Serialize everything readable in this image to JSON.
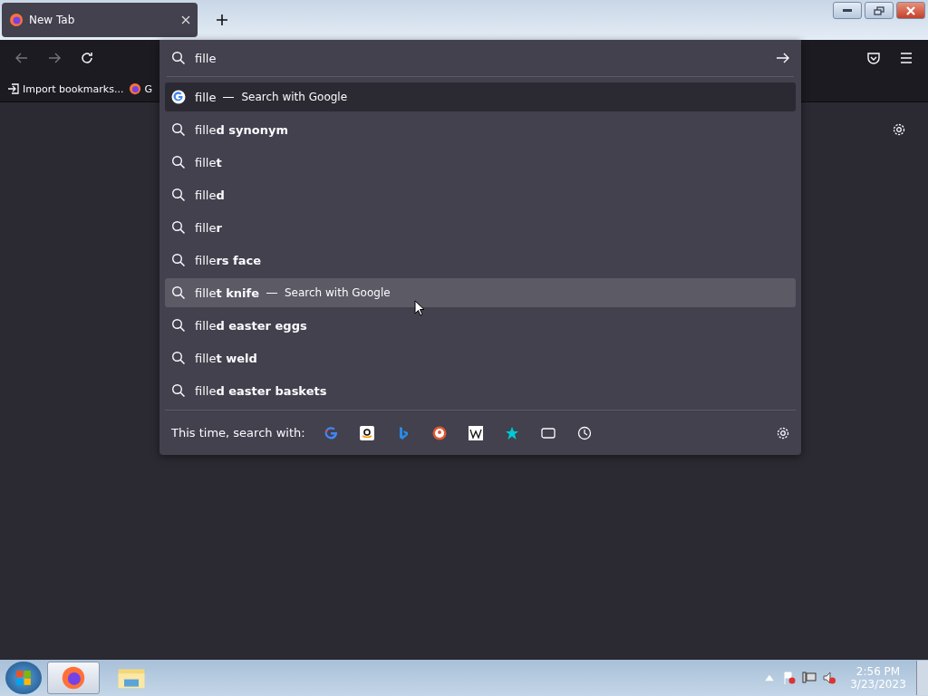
{
  "tab": {
    "title": "New Tab",
    "selected": true
  },
  "url_field": {
    "value": "fille"
  },
  "bookmarks": [
    "Import bookmarks...",
    "G"
  ],
  "suggestions": [
    {
      "kind": "engine",
      "text": "fille",
      "action": "Search with Google",
      "selected": true,
      "hovered": false
    },
    {
      "kind": "search",
      "text": "fille**d synonym**",
      "selected": false,
      "hovered": false
    },
    {
      "kind": "search",
      "text": "fille**t**",
      "selected": false,
      "hovered": false
    },
    {
      "kind": "search",
      "text": "fille**d**",
      "selected": false,
      "hovered": false
    },
    {
      "kind": "search",
      "text": "fille**r**",
      "selected": false,
      "hovered": false
    },
    {
      "kind": "search",
      "text": "fille**rs face**",
      "selected": false,
      "hovered": false
    },
    {
      "kind": "search",
      "text": "fille**t knife**",
      "action": "Search with Google",
      "selected": false,
      "hovered": true
    },
    {
      "kind": "search",
      "text": "fille**d easter eggs**",
      "selected": false,
      "hovered": false
    },
    {
      "kind": "search",
      "text": "fille**t weld**",
      "selected": false,
      "hovered": false
    },
    {
      "kind": "search",
      "text": "fille**d easter baskets**",
      "selected": false,
      "hovered": false
    }
  ],
  "one_off_label": "This time, search with:",
  "clock": {
    "time": "2:56 PM",
    "date": "3/23/2023"
  }
}
